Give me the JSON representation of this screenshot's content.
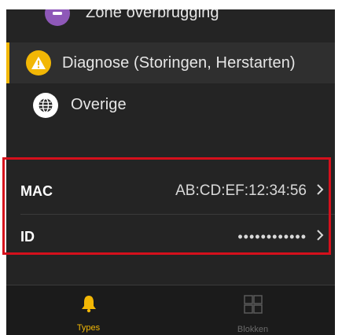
{
  "menu": {
    "items": [
      {
        "label": "Zone overbrugging",
        "icon": "zone-icon",
        "color": "#8e58b8",
        "active": false
      },
      {
        "label": "Diagnose (Storingen, Herstarten)",
        "icon": "warning-icon",
        "color": "#f2b705",
        "active": true
      },
      {
        "label": "Overige",
        "icon": "globe-icon",
        "color": "#ffffff",
        "active": false
      }
    ]
  },
  "device_info": {
    "mac_label": "MAC",
    "mac_value": "AB:CD:EF:12:34:56",
    "id_label": "ID",
    "id_value": "••••••••••••",
    "highlight_color": "#d5101c"
  },
  "tabbar": {
    "tabs": [
      {
        "label": "Types",
        "icon": "bell-icon",
        "active": true,
        "color": "#f2b705"
      },
      {
        "label": "Blokken",
        "icon": "grid-icon",
        "active": false,
        "color": "#6a6a6a"
      }
    ]
  },
  "colors": {
    "background": "#242424",
    "accent": "#f2b705"
  }
}
